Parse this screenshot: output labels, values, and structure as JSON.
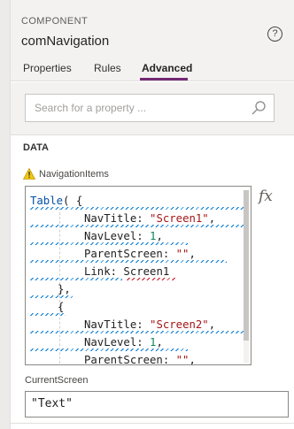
{
  "header": {
    "kind": "COMPONENT",
    "name": "comNavigation",
    "help_glyph": "?"
  },
  "tabs": [
    {
      "label": "Properties",
      "selected": false
    },
    {
      "label": "Rules",
      "selected": false
    },
    {
      "label": "Advanced",
      "selected": true
    }
  ],
  "colors": {
    "accent": "#742774",
    "keyword": "#0451a5",
    "string": "#a31515",
    "number": "#098658",
    "squiggle": "#0078d4",
    "warning": "#f2c811"
  },
  "search": {
    "placeholder": "Search for a property ...",
    "icon": "search-icon"
  },
  "section": {
    "title": "DATA"
  },
  "property": {
    "label": "NavigationItems",
    "warning_icon": "warning-icon",
    "fx_label": "fx",
    "code": {
      "l1_fn": "Table",
      "l1_rest": "( {",
      "l2_key": "NavTitle: ",
      "l2_val": "\"Screen1\"",
      "l2_end": ",",
      "l3_key": "NavLevel: ",
      "l3_val": "1",
      "l3_end": ",",
      "l4_key": "ParentScreen: ",
      "l4_val": "\"\"",
      "l4_end": ",",
      "l5_key": "Link: ",
      "l5_val": "Screen1",
      "l6": "},",
      "l7": "{",
      "l8_key": "NavTitle: ",
      "l8_val": "\"Screen2\"",
      "l8_end": ",",
      "l9_key": "NavLevel: ",
      "l9_val": "1",
      "l9_end": ",",
      "l10_key": "ParentScreen: ",
      "l10_val": "\"\"",
      "l10_end": ","
    }
  },
  "current_screen": {
    "label": "CurrentScreen",
    "value": "\"Text\""
  }
}
